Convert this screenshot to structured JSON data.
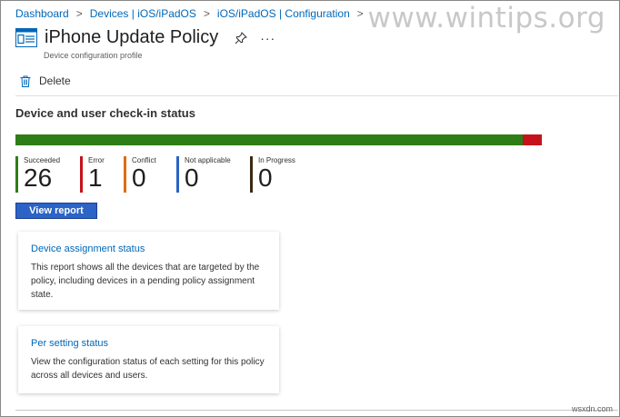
{
  "breadcrumb": [
    {
      "label": "Dashboard"
    },
    {
      "label": "Devices | iOS/iPadOS"
    },
    {
      "label": "iOS/iPadOS | Configuration"
    }
  ],
  "watermark": "www.wintips.org",
  "header": {
    "title": "iPhone Update Policy",
    "subtitle": "Device configuration profile",
    "more": "···"
  },
  "toolbar": {
    "delete_label": "Delete"
  },
  "checkin": {
    "section_title": "Device and user check-in status",
    "bar_colors": {
      "succeeded": "#2f7d16",
      "error": "#c4131b"
    },
    "bar_fraction": {
      "succeeded": 0.963,
      "error": 0.037
    },
    "stats": [
      {
        "label": "Succeeded",
        "value": "26",
        "color": "#2f7d16"
      },
      {
        "label": "Error",
        "value": "1",
        "color": "#c4131b"
      },
      {
        "label": "Conflict",
        "value": "0",
        "color": "#e06c12"
      },
      {
        "label": "Not applicable",
        "value": "0",
        "color": "#2b63c6"
      },
      {
        "label": "In Progress",
        "value": "0",
        "color": "#3b2a14"
      }
    ],
    "view_report_label": "View report"
  },
  "cards": [
    {
      "title": "Device assignment status",
      "description": "This report shows all the devices that are targeted by the policy, including devices in a pending policy assignment state."
    },
    {
      "title": "Per setting status",
      "description": "View the configuration status of each setting for this policy across all devices and users."
    }
  ],
  "credit": "wsxdn.com"
}
